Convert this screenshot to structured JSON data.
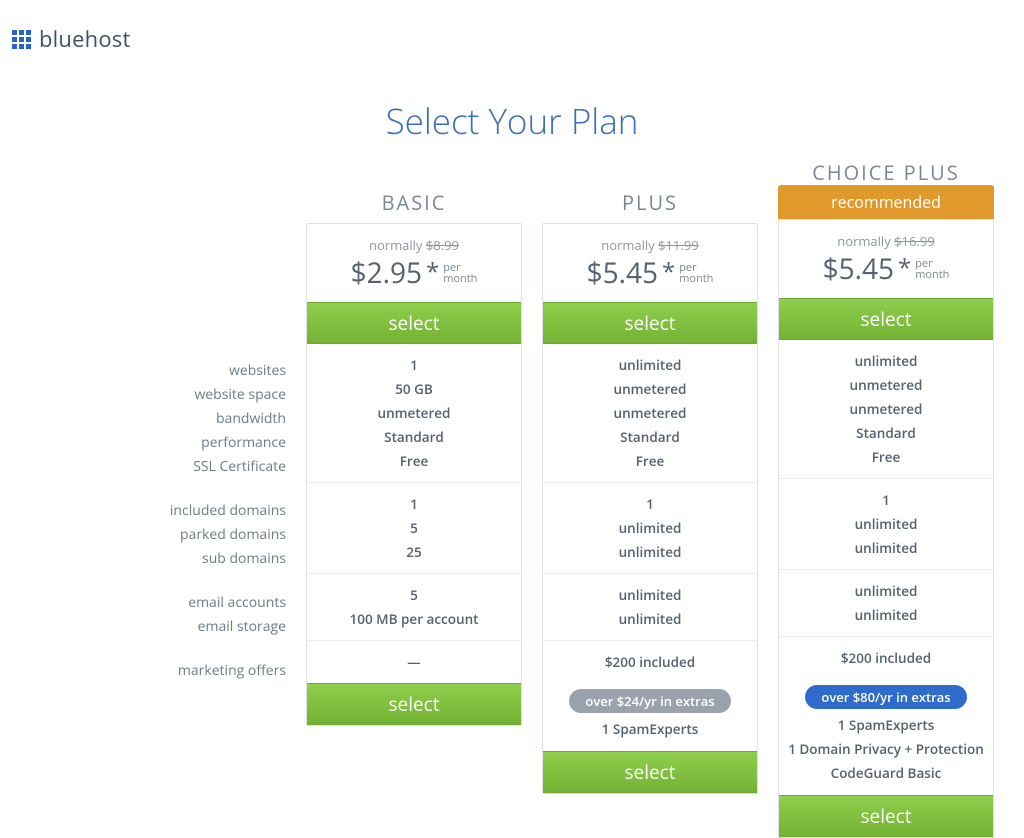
{
  "brand": {
    "name": "bluehost"
  },
  "page_title": "Select Your Plan",
  "feature_groups": [
    [
      "websites",
      "website space",
      "bandwidth",
      "performance",
      "SSL Certificate"
    ],
    [
      "included domains",
      "parked domains",
      "sub domains"
    ],
    [
      "email accounts",
      "email storage"
    ],
    [
      "marketing offers"
    ]
  ],
  "ui": {
    "normally_prefix": "normally ",
    "per": "per",
    "month": "month",
    "select_label": "select",
    "recommended_label": "recommended",
    "star": "*"
  },
  "plans": [
    {
      "name": "BASIC",
      "recommended": false,
      "normal_price": "$8.99",
      "price": "$2.95",
      "feature_values": [
        [
          "1",
          "50 GB",
          "unmetered",
          "Standard",
          "Free"
        ],
        [
          "1",
          "5",
          "25"
        ],
        [
          "5",
          "100 MB per account"
        ],
        [
          "—"
        ]
      ],
      "extras_pill": null,
      "extras": []
    },
    {
      "name": "PLUS",
      "recommended": false,
      "normal_price": "$11.99",
      "price": "$5.45",
      "feature_values": [
        [
          "unlimited",
          "unmetered",
          "unmetered",
          "Standard",
          "Free"
        ],
        [
          "1",
          "unlimited",
          "unlimited"
        ],
        [
          "unlimited",
          "unlimited"
        ],
        [
          "$200 included"
        ]
      ],
      "extras_pill": {
        "text": "over $24/yr in extras",
        "style": "grey"
      },
      "extras": [
        "1 SpamExperts"
      ]
    },
    {
      "name": "CHOICE PLUS",
      "recommended": true,
      "normal_price": "$16.99",
      "price": "$5.45",
      "feature_values": [
        [
          "unlimited",
          "unmetered",
          "unmetered",
          "Standard",
          "Free"
        ],
        [
          "1",
          "unlimited",
          "unlimited"
        ],
        [
          "unlimited",
          "unlimited"
        ],
        [
          "$200 included"
        ]
      ],
      "extras_pill": {
        "text": "over $80/yr in extras",
        "style": "blue"
      },
      "extras": [
        "1 SpamExperts",
        "1 Domain Privacy + Protection",
        "CodeGuard Basic"
      ]
    }
  ]
}
